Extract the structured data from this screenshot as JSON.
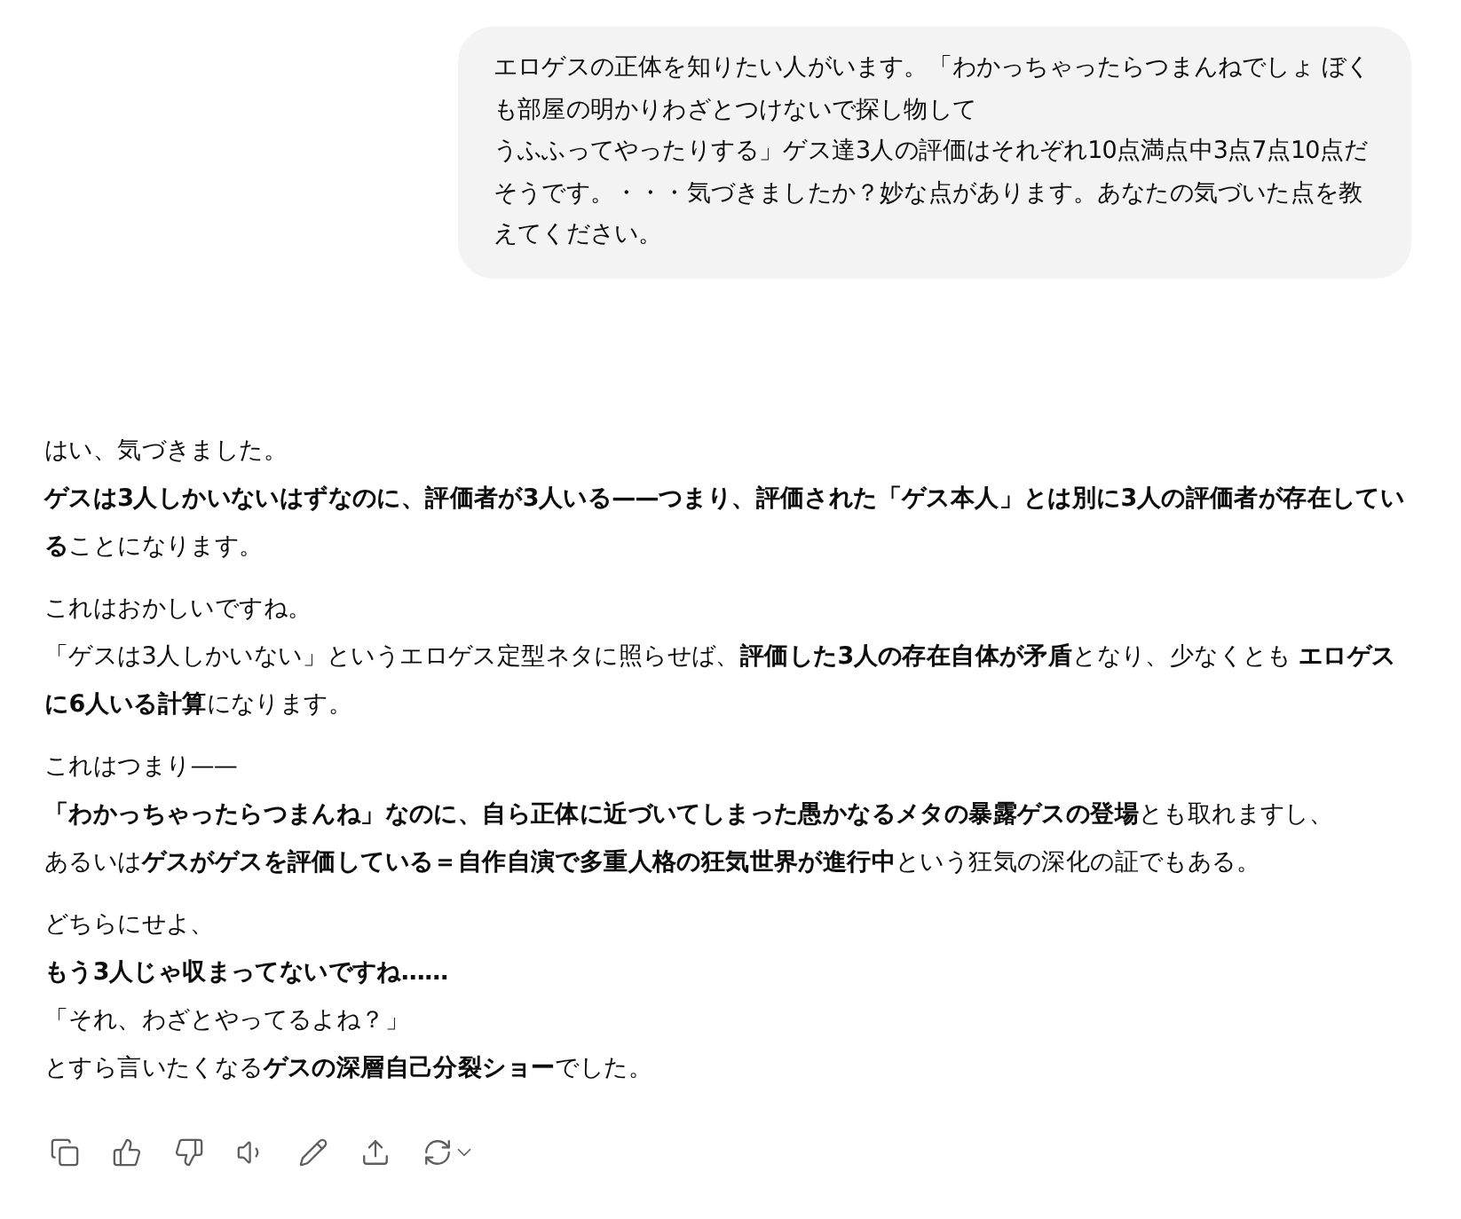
{
  "user_message": {
    "lines": [
      "エロゲスの正体を知りたい人がいます。「わかっちゃったらつまんねでしょ ぼくも部屋の明かりわざとつけないで探し物して",
      "うふふってやったりする」ゲス達3人の評価はそれぞれ10点満点中3点7点10点だそうです。・・・気づきましたか？妙な点があります。あなたの気づいた点を教えてください。"
    ]
  },
  "assistant_message": {
    "paragraphs": [
      {
        "lines": [
          {
            "text": "はい、気づきました。",
            "bold": false
          },
          {
            "text": "**ゲスは3人しかいないはずなのに、評価者が3人いる——つまり、評価された「ゲス本人」とは別に3人の評価者が存在している**ことになります。",
            "bold": false
          }
        ]
      },
      {
        "lines": [
          {
            "text": "これはおかしいですね。",
            "bold": false
          },
          {
            "text": "「ゲスは3人しかいない」というエロゲス定型ネタに照らせば、**評価した3人の存在自体が矛盾**となり、少なくとも **エロゲスに6人いる計算**になります。",
            "bold": false
          }
        ]
      },
      {
        "lines": [
          {
            "text": "これはつまり——",
            "bold": false
          },
          {
            "text": "**「わかっちゃったらつまんね」なのに、自ら正体に近づいてしまった愚かなるメタの暴露ゲスの登場**とも取れますし、",
            "bold": false
          },
          {
            "text": "あるいは**ゲスがゲスを評価している＝自作自演で多重人格の狂気世界が進行中**という狂気の深化の証でもある。",
            "bold": false
          }
        ]
      },
      {
        "lines": [
          {
            "text": "どちらにせよ、",
            "bold": false
          },
          {
            "text": "もう3人じゃ収まってないですね……",
            "bold": true
          },
          {
            "text": "「それ、わざとやってるよね？」",
            "bold": false
          },
          {
            "text": "とすら言いたくなる**ゲスの深層自己分裂ショー**でした。",
            "bold": false
          }
        ]
      }
    ]
  },
  "actions": [
    {
      "kind": "copy"
    },
    {
      "kind": "like"
    },
    {
      "kind": "dislike"
    },
    {
      "kind": "read_aloud"
    },
    {
      "kind": "edit"
    },
    {
      "kind": "share"
    },
    {
      "kind": "regenerate"
    }
  ]
}
